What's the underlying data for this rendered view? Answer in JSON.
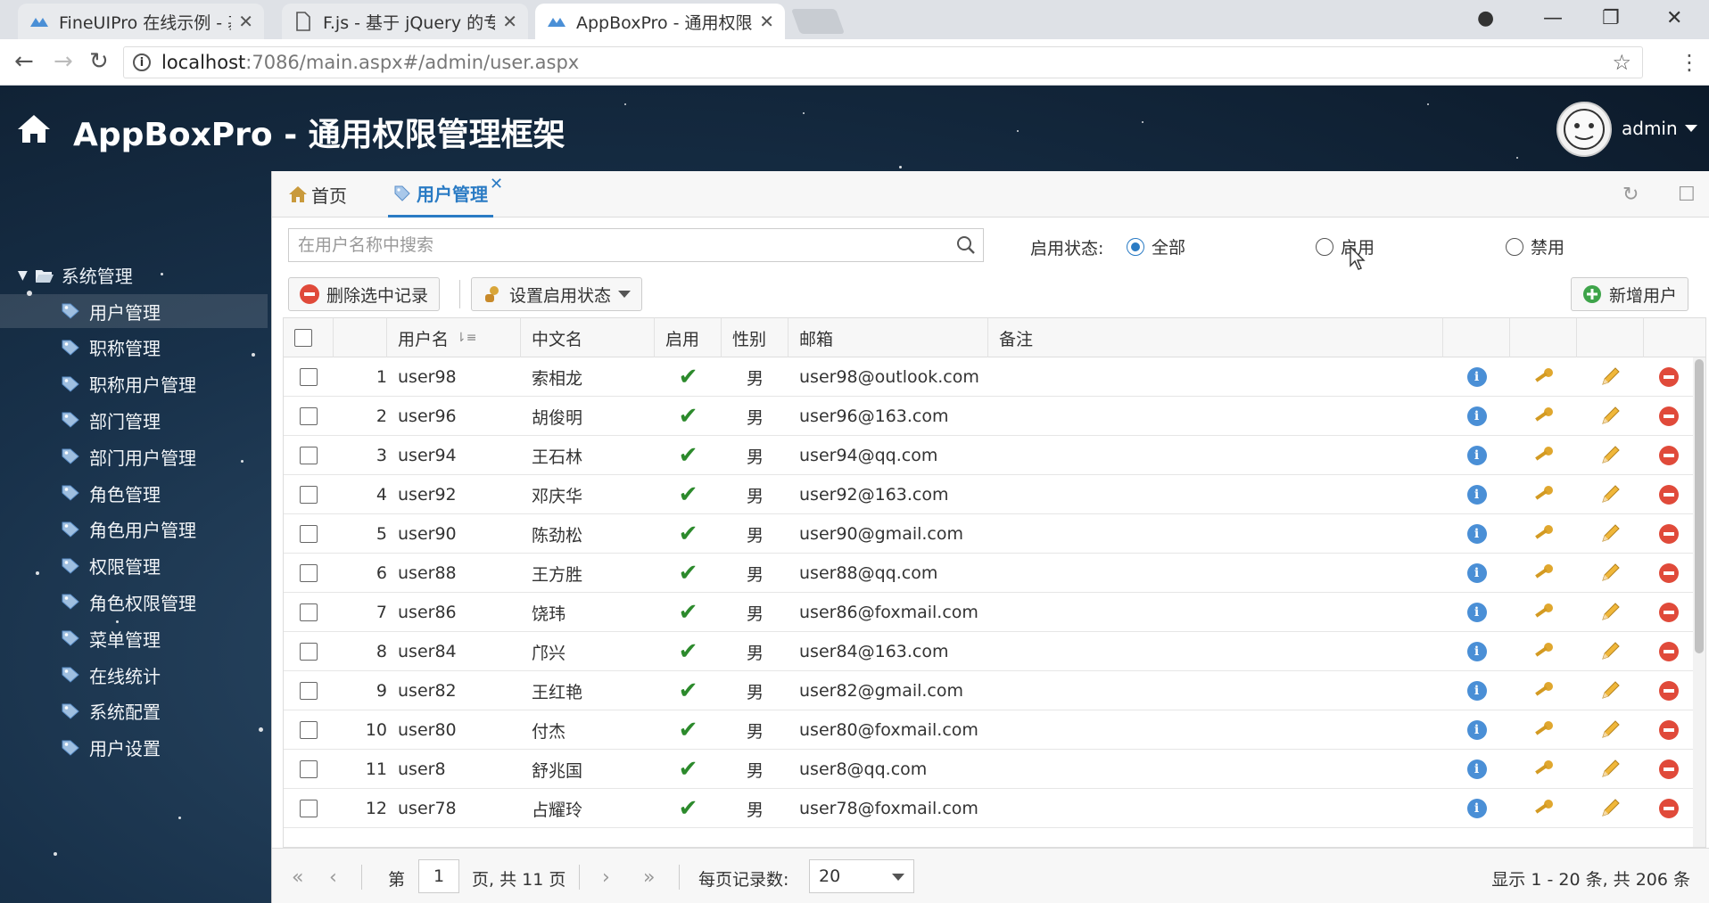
{
  "browser": {
    "tabs": [
      {
        "title": "FineUIPro 在线示例 - 基"
      },
      {
        "title": "F.js - 基于 jQuery 的专业"
      },
      {
        "title": "AppBoxPro - 通用权限管"
      }
    ],
    "url_host": "localhost",
    "url_path": ":7086/main.aspx#/admin/user.aspx"
  },
  "header": {
    "title": "AppBoxPro - 通用权限管理框架",
    "user": "admin"
  },
  "sidebar": {
    "root": "系统管理",
    "items": [
      {
        "label": "用户管理"
      },
      {
        "label": "职称管理"
      },
      {
        "label": "职称用户管理"
      },
      {
        "label": "部门管理"
      },
      {
        "label": "部门用户管理"
      },
      {
        "label": "角色管理"
      },
      {
        "label": "角色用户管理"
      },
      {
        "label": "权限管理"
      },
      {
        "label": "角色权限管理"
      },
      {
        "label": "菜单管理"
      },
      {
        "label": "在线统计"
      },
      {
        "label": "系统配置"
      },
      {
        "label": "用户设置"
      }
    ]
  },
  "main": {
    "tabs": [
      {
        "label": "首页"
      },
      {
        "label": "用户管理"
      }
    ],
    "search_placeholder": "在用户名称中搜索",
    "status_label": "启用状态:",
    "status_options": [
      "全部",
      "启用",
      "禁用"
    ],
    "toolbar": {
      "delete": "删除选中记录",
      "set_status": "设置启用状态",
      "add_user": "新增用户"
    },
    "columns": [
      "用户名",
      "中文名",
      "启用",
      "性别",
      "邮箱",
      "备注"
    ],
    "rows": [
      {
        "num": "1",
        "username": "user98",
        "name": "索相龙",
        "gender": "男",
        "email": "user98@outlook.com"
      },
      {
        "num": "2",
        "username": "user96",
        "name": "胡俊明",
        "gender": "男",
        "email": "user96@163.com"
      },
      {
        "num": "3",
        "username": "user94",
        "name": "王石林",
        "gender": "男",
        "email": "user94@qq.com"
      },
      {
        "num": "4",
        "username": "user92",
        "name": "邓庆华",
        "gender": "男",
        "email": "user92@163.com"
      },
      {
        "num": "5",
        "username": "user90",
        "name": "陈劲松",
        "gender": "男",
        "email": "user90@gmail.com"
      },
      {
        "num": "6",
        "username": "user88",
        "name": "王方胜",
        "gender": "男",
        "email": "user88@qq.com"
      },
      {
        "num": "7",
        "username": "user86",
        "name": "饶玮",
        "gender": "男",
        "email": "user86@foxmail.com"
      },
      {
        "num": "8",
        "username": "user84",
        "name": "邝兴",
        "gender": "男",
        "email": "user84@163.com"
      },
      {
        "num": "9",
        "username": "user82",
        "name": "王红艳",
        "gender": "男",
        "email": "user82@gmail.com"
      },
      {
        "num": "10",
        "username": "user80",
        "name": "付杰",
        "gender": "男",
        "email": "user80@foxmail.com"
      },
      {
        "num": "11",
        "username": "user8",
        "name": "舒兆国",
        "gender": "男",
        "email": "user8@qq.com"
      },
      {
        "num": "12",
        "username": "user78",
        "name": "占耀玲",
        "gender": "男",
        "email": "user78@foxmail.com"
      }
    ],
    "pager": {
      "page_prefix": "第",
      "page": "1",
      "page_suffix": "页, 共 11 页",
      "size_label": "每页记录数:",
      "size": "20",
      "summary": "显示 1 - 20 条, 共 206 条"
    }
  },
  "colors": {
    "accent": "#2a7bc4",
    "check": "#2c8a2c",
    "danger": "#e04a3a",
    "info": "#4a8fd6"
  }
}
